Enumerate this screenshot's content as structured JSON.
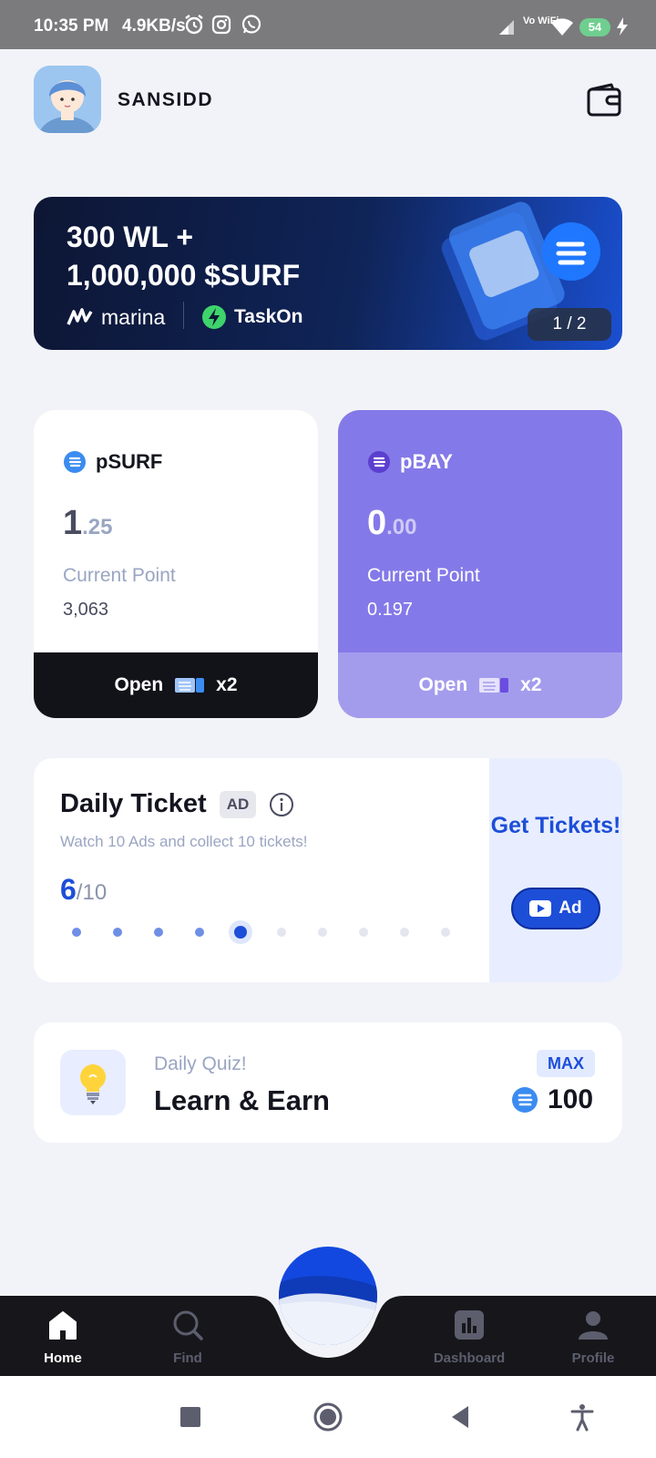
{
  "status_bar": {
    "time": "10:35 PM",
    "network_speed": "4.9KB/s",
    "wifi_label": "Vo WiFi",
    "battery": "54",
    "icons": [
      "alarm-icon",
      "instagram-icon",
      "whatsapp-icon",
      "signal-icon",
      "wifi-icon",
      "battery-icon",
      "charging-icon"
    ]
  },
  "header": {
    "username": "SANSIDD",
    "wallet_icon": "wallet-icon"
  },
  "banner": {
    "line1": "300 WL +",
    "line2": "1,000,000 $SURF",
    "brand1": "marina",
    "brand2": "TaskOn",
    "pager": "1 / 2"
  },
  "cards": {
    "psurf": {
      "title": "pSURF",
      "value_int": "1",
      "value_dec": ".25",
      "label": "Current Point",
      "points": "3,063",
      "button_label": "Open",
      "button_multiplier": "x2"
    },
    "pbay": {
      "title": "pBAY",
      "value_int": "0",
      "value_dec": ".00",
      "label": "Current Point",
      "points": "0.197",
      "button_label": "Open",
      "button_multiplier": "x2"
    }
  },
  "daily_ticket": {
    "title": "Daily Ticket",
    "ad_tag": "AD",
    "subtitle": "Watch 10 Ads and collect 10 tickets!",
    "current": "6",
    "total": "/10",
    "dots_filled": 5,
    "dots_total": 10,
    "side_title": "Get Tickets!",
    "ad_button": "Ad"
  },
  "quiz": {
    "subtitle": "Daily Quiz!",
    "title": "Learn & Earn",
    "max_tag": "MAX",
    "reward": "100"
  },
  "nav": {
    "home": "Home",
    "find": "Find",
    "dashboard": "Dashboard",
    "profile": "Profile"
  },
  "colors": {
    "accent": "#1d4ed8",
    "pbay": "#8479e8",
    "dark": "#121219"
  }
}
